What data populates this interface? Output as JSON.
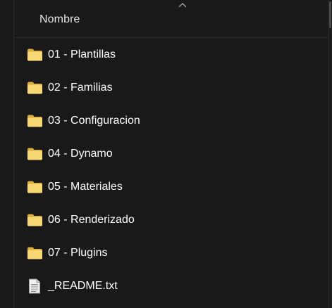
{
  "header": {
    "column_name": "Nombre",
    "sort_direction": "ascending"
  },
  "files": [
    {
      "name": "01 - Plantillas",
      "icon": "folder-icon",
      "type": "folder"
    },
    {
      "name": "02 - Familias",
      "icon": "folder-icon",
      "type": "folder"
    },
    {
      "name": "03 - Configuracion",
      "icon": "folder-icon",
      "type": "folder"
    },
    {
      "name": "04 - Dynamo",
      "icon": "folder-icon",
      "type": "folder"
    },
    {
      "name": "05 - Materiales",
      "icon": "folder-icon",
      "type": "folder"
    },
    {
      "name": "06 - Renderizado",
      "icon": "folder-icon",
      "type": "folder"
    },
    {
      "name": "07 - Plugins",
      "icon": "folder-icon",
      "type": "folder"
    },
    {
      "name": "_README.txt",
      "icon": "text-file-icon",
      "type": "file"
    }
  ],
  "colors": {
    "background": "#191919",
    "text": "#ffffff",
    "folder_yellow": "#f8d775",
    "folder_dark_yellow": "#e3b341"
  }
}
